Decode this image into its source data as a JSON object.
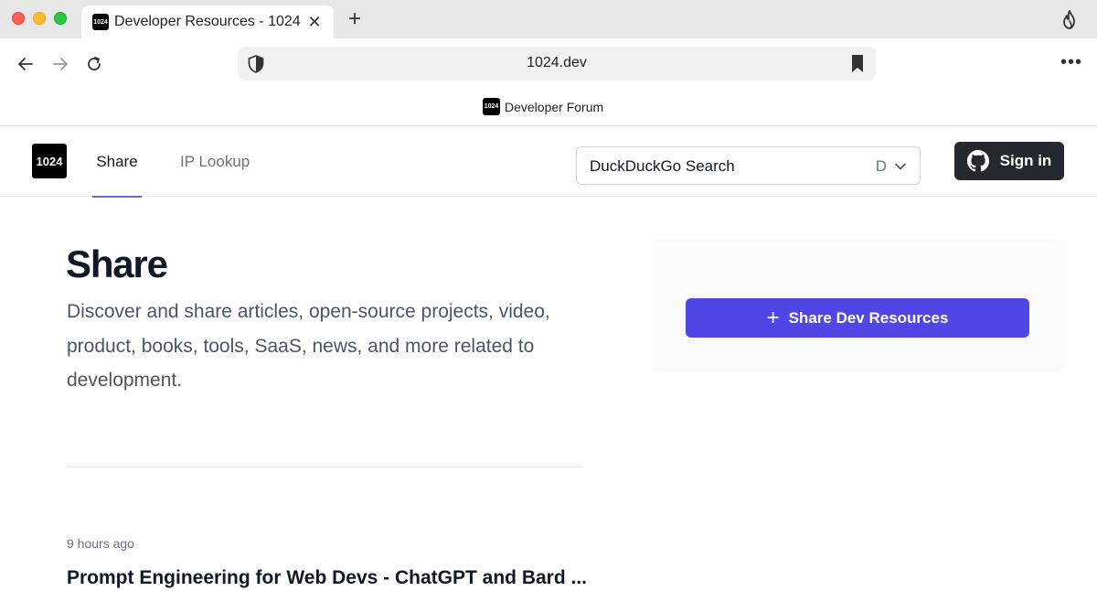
{
  "browser": {
    "tab": {
      "favicon_text": "1024",
      "title": "Developer Resources - 1024",
      "close": "✕"
    },
    "new_tab": "+",
    "url": "1024.dev",
    "more": "•••",
    "bookmarks": [
      {
        "favicon_text": "1024",
        "label": "Developer Forum"
      }
    ],
    "traffic_colors": {
      "close": "#fe5f57",
      "minimize": "#febc2e",
      "zoom": "#28c840"
    }
  },
  "header": {
    "logo_text": "1024",
    "nav": [
      {
        "label": "Share",
        "active": true
      },
      {
        "label": "IP Lookup",
        "active": false
      }
    ],
    "search": {
      "engine": "DuckDuckGo Search",
      "shortcut": "D"
    },
    "signin_label": "Sign in"
  },
  "main": {
    "title": "Share",
    "description": "Discover and share articles, open-source projects, video, product, books, tools, SaaS, news, and more related to development.",
    "share_button": {
      "icon": "+",
      "label": "Share Dev Resources"
    },
    "posts": [
      {
        "time": "9 hours ago",
        "title": "Prompt Engineering for Web Devs - ChatGPT and Bard ..."
      }
    ]
  },
  "colors": {
    "accent": "#4f46e5",
    "nav_underline": "#6366f1",
    "signin_bg": "#24292f"
  }
}
